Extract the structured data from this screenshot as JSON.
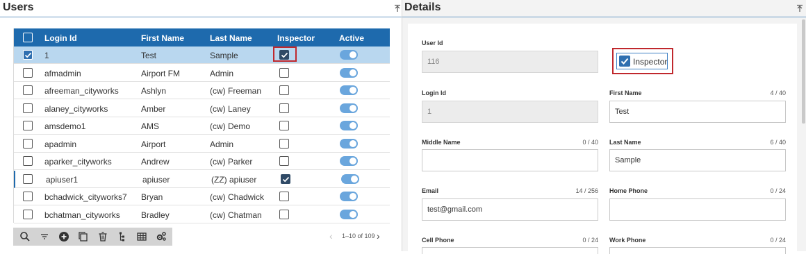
{
  "left": {
    "title": "Users",
    "columns": [
      "Login Id",
      "First Name",
      "Last Name",
      "Inspector",
      "Active"
    ],
    "rows": [
      {
        "login": "1",
        "first": "Test",
        "last": "Sample",
        "inspector": true,
        "active": true,
        "selected": true
      },
      {
        "login": "afmadmin",
        "first": "Airport FM",
        "last": "Admin",
        "inspector": false,
        "active": true,
        "selected": false
      },
      {
        "login": "afreeman_cityworks",
        "first": "Ashlyn",
        "last": "(cw) Freeman",
        "inspector": false,
        "active": true,
        "selected": false
      },
      {
        "login": "alaney_cityworks",
        "first": "Amber",
        "last": "(cw) Laney",
        "inspector": false,
        "active": true,
        "selected": false
      },
      {
        "login": "amsdemo1",
        "first": "AMS",
        "last": "(cw) Demo",
        "inspector": false,
        "active": true,
        "selected": false
      },
      {
        "login": "apadmin",
        "first": "Airport",
        "last": "Admin",
        "inspector": false,
        "active": true,
        "selected": false
      },
      {
        "login": "aparker_cityworks",
        "first": "Andrew",
        "last": "(cw) Parker",
        "inspector": false,
        "active": true,
        "selected": false
      },
      {
        "login": "apiuser1",
        "first": "apiuser",
        "last": "(ZZ) apiuser",
        "inspector": true,
        "active": true,
        "selected": false
      },
      {
        "login": "bchadwick_cityworks7",
        "first": "Bryan",
        "last": "(cw) Chadwick",
        "inspector": false,
        "active": true,
        "selected": false
      },
      {
        "login": "bchatman_cityworks",
        "first": "Bradley",
        "last": "(cw) Chatman",
        "inspector": false,
        "active": true,
        "selected": false
      }
    ],
    "toolbar_icons": [
      "search-icon",
      "filter-icon",
      "add-icon",
      "copy-icon",
      "delete-icon",
      "hierarchy-icon",
      "table-icon",
      "settings-icon"
    ],
    "pager": {
      "text": "1–10 of 109",
      "prev_symbol": "‹",
      "next_symbol": "›"
    }
  },
  "right": {
    "title": "Details",
    "user_id": {
      "label": "User Id",
      "value": "116"
    },
    "inspector": {
      "label": "Inspector",
      "checked": true
    },
    "login_id": {
      "label": "Login Id",
      "value": "1"
    },
    "first_name": {
      "label": "First Name",
      "count": "4 / 40",
      "value": "Test"
    },
    "middle_name": {
      "label": "Middle Name",
      "count": "0 / 40",
      "value": ""
    },
    "last_name": {
      "label": "Last Name",
      "count": "6 / 40",
      "value": "Sample"
    },
    "email": {
      "label": "Email",
      "count": "14 / 256",
      "value": "test@gmail.com"
    },
    "home_phone": {
      "label": "Home Phone",
      "count": "0 / 24",
      "value": ""
    },
    "cell_phone": {
      "label": "Cell Phone",
      "count": "0 / 24"
    },
    "work_phone": {
      "label": "Work Phone",
      "count": "0 / 24"
    }
  },
  "colors": {
    "header_blue": "#1e6aad",
    "selected_row": "#b9d7ef",
    "toggle_on": "#6aa6dd",
    "highlight_red": "#c0282d"
  }
}
